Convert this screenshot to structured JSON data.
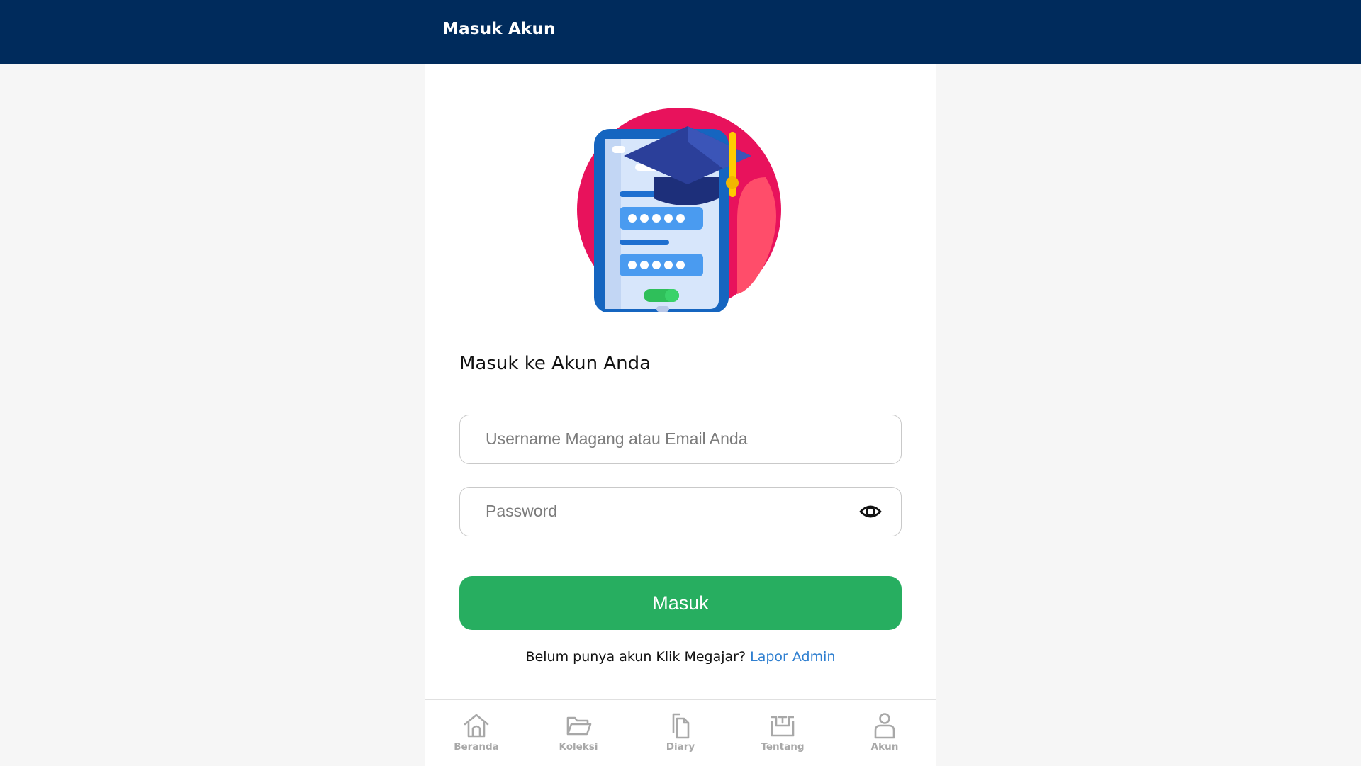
{
  "header": {
    "title": "Masuk Akun"
  },
  "login": {
    "heading": "Masuk ke Akun Anda",
    "username_placeholder": "Username Magang atau Email Anda",
    "username_value": "",
    "password_placeholder": "Password",
    "password_value": "",
    "submit_label": "Masuk",
    "signup_prompt": "Belum punya akun Klik Megajar?",
    "signup_link": "Lapor Admin"
  },
  "icons": {
    "hero": "phone-login-graduation-cap-illustration",
    "password_toggle": "eye-icon"
  },
  "nav": {
    "items": [
      {
        "label": "Beranda",
        "icon": "home-icon"
      },
      {
        "label": "Koleksi",
        "icon": "folder-icon"
      },
      {
        "label": "Diary",
        "icon": "documents-icon"
      },
      {
        "label": "Tentang",
        "icon": "info-box-icon"
      },
      {
        "label": "Akun",
        "icon": "user-icon"
      }
    ]
  },
  "colors": {
    "header": "#002b5c",
    "primary_button": "#27ae60",
    "link": "#2f7fd0",
    "nav_inactive": "#a8a8a8"
  }
}
